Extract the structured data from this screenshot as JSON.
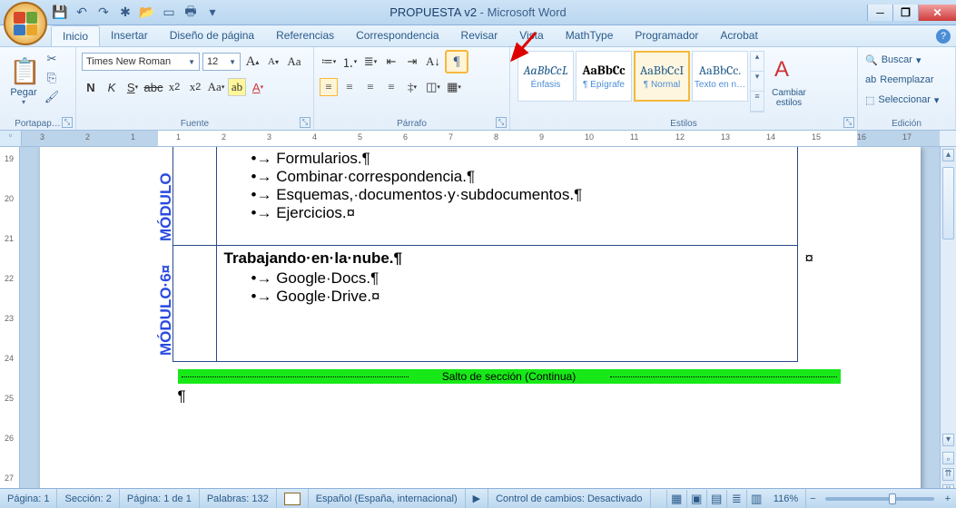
{
  "title": {
    "doc": "PROPUESTA v2",
    "app": "Microsoft Word"
  },
  "tabs": [
    "Inicio",
    "Insertar",
    "Diseño de página",
    "Referencias",
    "Correspondencia",
    "Revisar",
    "Vista",
    "MathType",
    "Programador",
    "Acrobat"
  ],
  "clipboard": {
    "paste": "Pegar",
    "group": "Portapap…"
  },
  "font": {
    "name": "Times New Roman",
    "size": "12",
    "group": "Fuente"
  },
  "para": {
    "group": "Párrafo"
  },
  "styles": {
    "group": "Estilos",
    "items": [
      {
        "preview": "AaBbCcL",
        "name": "Énfasis"
      },
      {
        "preview": "AaBbCc",
        "name": "¶ Epígrafe"
      },
      {
        "preview": "AaBbCcI",
        "name": "¶ Normal"
      },
      {
        "preview": "AaBbCc.",
        "name": "Texto en n…"
      }
    ],
    "change": "Cambiar estilos"
  },
  "edit": {
    "group": "Edición",
    "find": "Buscar",
    "replace": "Reemplazar",
    "select": "Seleccionar"
  },
  "document": {
    "module1_label": "MÓDULO",
    "module1_items": [
      "Formularios.¶",
      "Combinar·correspondencia.¶",
      "Esquemas,·documentos·y·subdocumentos.¶",
      "Ejercicios.¤"
    ],
    "module2_label": "MÓDULO·6¤",
    "module2_heading": "Trabajando·en·la·nube.¶",
    "module2_items": [
      "Google·Docs.¶",
      "Google·Drive.¤"
    ],
    "end_marker": "¤",
    "section_break": "Salto de sección (Continua)",
    "para_mark": "¶"
  },
  "ruler_nums": [
    "3",
    "2",
    "1",
    "1",
    "2",
    "3",
    "4",
    "5",
    "6",
    "7",
    "8",
    "9",
    "10",
    "11",
    "12",
    "13",
    "14",
    "15",
    "16",
    "17"
  ],
  "vruler_nums": [
    "19",
    "20",
    "21",
    "22",
    "23",
    "24",
    "25",
    "26",
    "27"
  ],
  "status": {
    "page": "Página: 1",
    "section": "Sección: 2",
    "pageof": "Página: 1 de 1",
    "words": "Palabras: 132",
    "lang": "Español (España, internacional)",
    "track": "Control de cambios: Desactivado",
    "zoom": "116%"
  }
}
